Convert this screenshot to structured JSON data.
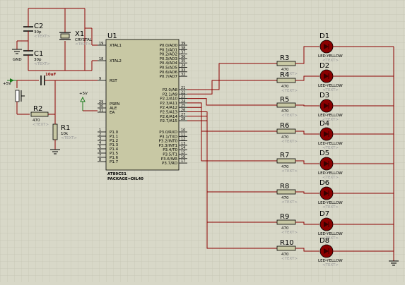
{
  "mcu": {
    "ref": "U1",
    "part": "AT89C51",
    "package": "PACKAGE=DIL40",
    "left_pins": [
      {
        "name": "XTAL1",
        "num": "19"
      },
      {
        "name": "XTAL2",
        "num": "18"
      },
      {
        "name": "RST",
        "num": "9"
      },
      {
        "name": "PSEN",
        "num": "29"
      },
      {
        "name": "ALE",
        "num": "30"
      },
      {
        "name": "EA",
        "num": "31"
      },
      {
        "name": "P1.0",
        "num": "1"
      },
      {
        "name": "P1.1",
        "num": "2"
      },
      {
        "name": "P1.2",
        "num": "3"
      },
      {
        "name": "P1.3",
        "num": "4"
      },
      {
        "name": "P1.4",
        "num": "5"
      },
      {
        "name": "P1.5",
        "num": "6"
      },
      {
        "name": "P1.6",
        "num": "7"
      },
      {
        "name": "P1.7",
        "num": "8"
      }
    ],
    "right_pins": [
      {
        "name": "P0.0/AD0",
        "num": "39"
      },
      {
        "name": "P0.1/AD1",
        "num": "38"
      },
      {
        "name": "P0.2/AD2",
        "num": "37"
      },
      {
        "name": "P0.3/AD3",
        "num": "36"
      },
      {
        "name": "P0.4/AD4",
        "num": "35"
      },
      {
        "name": "P0.5/AD5",
        "num": "34"
      },
      {
        "name": "P0.6/AD6",
        "num": "33"
      },
      {
        "name": "P0.7/AD7",
        "num": "32"
      },
      {
        "name": "P2.0/A8",
        "num": "21"
      },
      {
        "name": "P2.1/A9",
        "num": "22"
      },
      {
        "name": "P2.2/A10",
        "num": "23"
      },
      {
        "name": "P2.3/A11",
        "num": "24"
      },
      {
        "name": "P2.4/A12",
        "num": "25"
      },
      {
        "name": "P2.5/A13",
        "num": "26"
      },
      {
        "name": "P2.6/A14",
        "num": "27"
      },
      {
        "name": "P2.7/A15",
        "num": "28"
      },
      {
        "name": "P3.0/RXD",
        "num": "10"
      },
      {
        "name": "P3.1/TXD",
        "num": "11"
      },
      {
        "name": "P3.2/INT0",
        "num": "12"
      },
      {
        "name": "P3.3/INT1",
        "num": "13"
      },
      {
        "name": "P3.4/T0",
        "num": "14"
      },
      {
        "name": "P3.5/T1",
        "num": "15"
      },
      {
        "name": "P3.6/WR",
        "num": "16"
      },
      {
        "name": "P3.7/RD",
        "num": "17"
      }
    ]
  },
  "caps": [
    {
      "ref": "C2",
      "value": "30p",
      "text": "<TEXT>"
    },
    {
      "ref": "C1",
      "value": "30p",
      "text": "<TEXT>"
    },
    {
      "ref": "",
      "value": "10uF",
      "text": ""
    }
  ],
  "crystal": {
    "ref": "X1",
    "value": "CRYSTAL",
    "text": "<TEXT>"
  },
  "resistors_input": [
    {
      "ref": "R2",
      "value": "470",
      "text": "<TEXT>"
    },
    {
      "ref": "R1",
      "value": "10k",
      "text": "<TEXT>"
    }
  ],
  "leds": [
    {
      "rref": "R3",
      "rval": "470",
      "rtext": "<TEXT>",
      "dref": "D1",
      "dval": "LED-YELLOW",
      "dtext": "<TEXT>"
    },
    {
      "rref": "R4",
      "rval": "470",
      "rtext": "<TEXT>",
      "dref": "D2",
      "dval": "LED-YELLOW",
      "dtext": "<TEXT>"
    },
    {
      "rref": "R5",
      "rval": "470",
      "rtext": "<TEXT>",
      "dref": "D3",
      "dval": "LED-YELLOW",
      "dtext": "<TEXT>"
    },
    {
      "rref": "R6",
      "rval": "470",
      "rtext": "<TEXT>",
      "dref": "D4",
      "dval": "LED-YELLOW",
      "dtext": "<TEXT>"
    },
    {
      "rref": "R7",
      "rval": "470",
      "rtext": "<TEXT>",
      "dref": "D5",
      "dval": "LED-YELLOW",
      "dtext": "<TEXT>"
    },
    {
      "rref": "R8",
      "rval": "470",
      "rtext": "<TEXT>",
      "dref": "D6",
      "dval": "LED-YELLOW",
      "dtext": "<TEXT>"
    },
    {
      "rref": "R9",
      "rval": "470",
      "rtext": "<TEXT>",
      "dref": "D7",
      "dval": "LED-YELLOW",
      "dtext": "<TEXT>"
    },
    {
      "rref": "R10",
      "rval": "470",
      "rtext": "<TEXT>",
      "dref": "D8",
      "dval": "LED-YELLOW",
      "dtext": "<TEXT>"
    }
  ],
  "power": {
    "vcc1": "+5V",
    "vcc2": "+5V",
    "gnd": "GND"
  },
  "colors": {
    "background": "#d8d8c8",
    "grid": "#c4c4b2",
    "wire": "#8b0000",
    "chip_fill": "#c8c8a4",
    "led_fill": "#8b0000",
    "resistor_fill": "#c8c8a4"
  }
}
